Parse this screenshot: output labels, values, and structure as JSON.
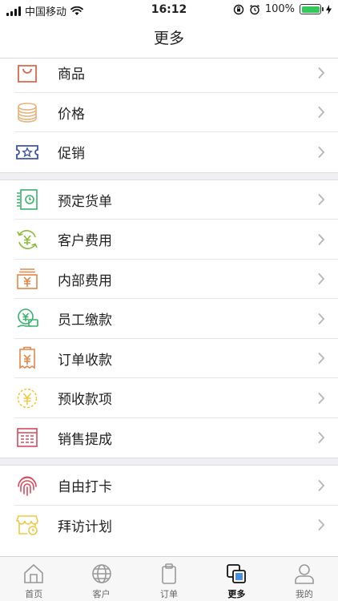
{
  "status_bar": {
    "carrier": "中国移动",
    "time": "16:12",
    "battery": "100%",
    "battery_level": 1.0
  },
  "nav": {
    "title": "更多"
  },
  "groups": [
    [
      {
        "label": "商品",
        "icon": "shopping-bag-icon"
      },
      {
        "label": "价格",
        "icon": "coin-stack-icon"
      },
      {
        "label": "促销",
        "icon": "coupon-star-icon"
      }
    ],
    [
      {
        "label": "预定货单",
        "icon": "reserve-order-icon"
      },
      {
        "label": "客户费用",
        "icon": "customer-fee-icon"
      },
      {
        "label": "内部费用",
        "icon": "internal-fee-icon"
      },
      {
        "label": "员工缴款",
        "icon": "employee-payment-icon"
      },
      {
        "label": "订单收款",
        "icon": "order-receipt-icon"
      },
      {
        "label": "预收款项",
        "icon": "advance-payment-icon"
      },
      {
        "label": "销售提成",
        "icon": "sales-commission-icon"
      }
    ],
    [
      {
        "label": "自由打卡",
        "icon": "fingerprint-icon"
      },
      {
        "label": "拜访计划",
        "icon": "visit-plan-icon"
      }
    ]
  ],
  "tabs": [
    {
      "label": "首页",
      "icon": "home-icon"
    },
    {
      "label": "客户",
      "icon": "globe-icon"
    },
    {
      "label": "订单",
      "icon": "order-icon"
    },
    {
      "label": "更多",
      "icon": "more-icon"
    },
    {
      "label": "我的",
      "icon": "profile-icon"
    }
  ],
  "colors": {
    "bag": "#d9674a",
    "coin": "#e8b27a",
    "coupon": "#3f53a3",
    "green": "#39b26b",
    "lightgreen": "#8dbb3a",
    "orange": "#e5864a",
    "yellow": "#f0c846",
    "red": "#d9495a",
    "accent": "#4a90e2"
  }
}
